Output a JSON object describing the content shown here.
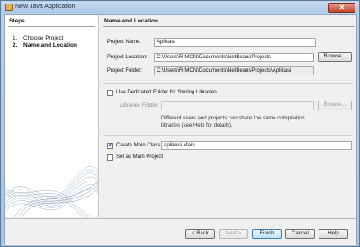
{
  "window": {
    "title": "New Java Application",
    "close_glyph": "✕"
  },
  "steps": {
    "heading": "Steps",
    "items": [
      {
        "num": "1.",
        "label": "Choose Project"
      },
      {
        "num": "2.",
        "label": "Name and Location"
      }
    ]
  },
  "content": {
    "heading": "Name and Location",
    "project_name_label": "Project Name:",
    "project_name_value": "Aplikasi",
    "project_location_label": "Project Location:",
    "project_location_value": "C:\\Users\\R-MON\\Documents\\NetBeansProjects",
    "browse_label": "Browse...",
    "project_folder_label": "Project Folder:",
    "project_folder_value": "C:\\Users\\R-MON\\Documents\\NetBeansProjects\\Aplikasi",
    "dedicated_folder_label": "Use Dedicated Folder for Storing Libraries",
    "libraries_folder_label": "Libraries Folder:",
    "libraries_browse_label": "Browse...",
    "libraries_note": "Different users and projects can share the same compilation libraries (see Help for details).",
    "create_main_class_label": "Create Main Class",
    "create_main_class_checked": true,
    "main_class_value": "aplikasi.Main",
    "set_main_project_label": "Set as Main Project",
    "set_main_project_checked": false
  },
  "footer": {
    "back_label": "< Back",
    "next_label": "Next >",
    "finish_label": "Finish",
    "cancel_label": "Cancel",
    "help_label": "Help"
  },
  "colors": {
    "accent": "#3c7fb1",
    "titlebar": "#aac5e6",
    "close": "#c0432c"
  }
}
